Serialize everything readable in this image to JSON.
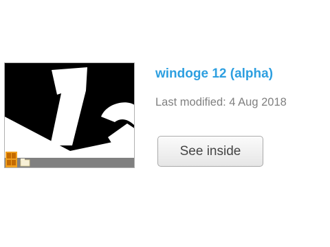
{
  "project": {
    "title": "windoge 12 (alpha)",
    "last_modified_label": "Last modified: 4 Aug 2018",
    "see_inside_label": "See inside"
  },
  "thumbnail": {
    "description_icon": "windoge-12-preview-thumbnail",
    "colors": {
      "background": "#000000",
      "foreground": "#ffffff",
      "taskbar": "#808080",
      "start_icon": "#f0a020"
    }
  },
  "colors": {
    "title": "#2d9fe0",
    "muted_text": "#808080",
    "button_text": "#444444"
  }
}
